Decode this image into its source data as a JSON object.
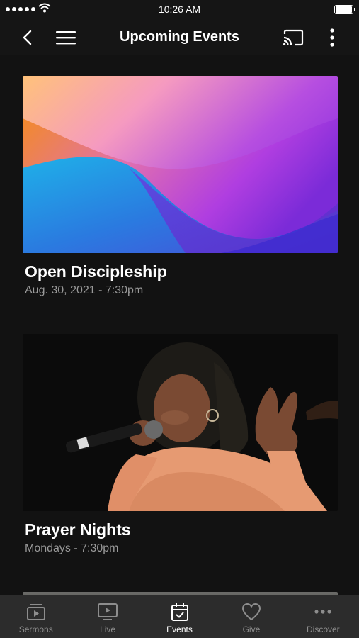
{
  "status_bar": {
    "time": "10:26 AM"
  },
  "header": {
    "title": "Upcoming Events"
  },
  "events": [
    {
      "title": "Open Discipleship",
      "date": "Aug. 30, 2021 - 7:30pm"
    },
    {
      "title": "Prayer Nights",
      "date": "Mondays - 7:30pm"
    }
  ],
  "tabs": [
    {
      "label": "Sermons",
      "icon": "sermons-icon",
      "active": false
    },
    {
      "label": "Live",
      "icon": "live-tv-icon",
      "active": false
    },
    {
      "label": "Events",
      "icon": "calendar-check-icon",
      "active": true
    },
    {
      "label": "Give",
      "icon": "heart-icon",
      "active": false
    },
    {
      "label": "Discover",
      "icon": "more-dots-icon",
      "active": false
    }
  ],
  "colors": {
    "background": "#121212",
    "tab_bar": "#2c2c2c",
    "tab_inactive": "#8d8d8d",
    "tab_active": "#ffffff",
    "date_text": "#9a9a9a"
  }
}
